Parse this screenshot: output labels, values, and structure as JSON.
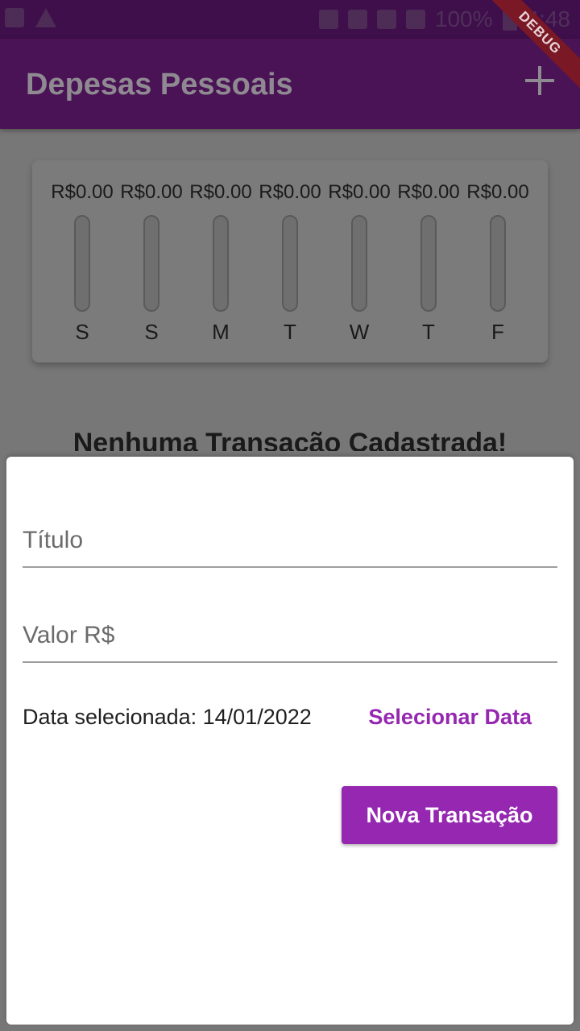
{
  "app": {
    "title": "Depesas Pessoais",
    "debug_label": "DEBUG"
  },
  "status_bar": {
    "battery": "100%",
    "time": "4:48"
  },
  "chart": {
    "days": [
      {
        "label": "S",
        "value_text": "R$0.00",
        "fill": 0
      },
      {
        "label": "S",
        "value_text": "R$0.00",
        "fill": 0
      },
      {
        "label": "M",
        "value_text": "R$0.00",
        "fill": 0
      },
      {
        "label": "T",
        "value_text": "R$0.00",
        "fill": 0
      },
      {
        "label": "W",
        "value_text": "R$0.00",
        "fill": 0
      },
      {
        "label": "T",
        "value_text": "R$0.00",
        "fill": 0
      },
      {
        "label": "F",
        "value_text": "R$0.00",
        "fill": 0
      }
    ]
  },
  "empty_message": "Nenhuma Transação Cadastrada!",
  "form": {
    "title_placeholder": "Título",
    "value_placeholder": "Valor R$",
    "date_text": "Data selecionada: 14/01/2022",
    "select_date_label": "Selecionar Data",
    "submit_label": "Nova Transação"
  },
  "colors": {
    "primary": "#9527b0",
    "app_bar": "#4a1355",
    "status_bar": "#3f0f4b"
  }
}
